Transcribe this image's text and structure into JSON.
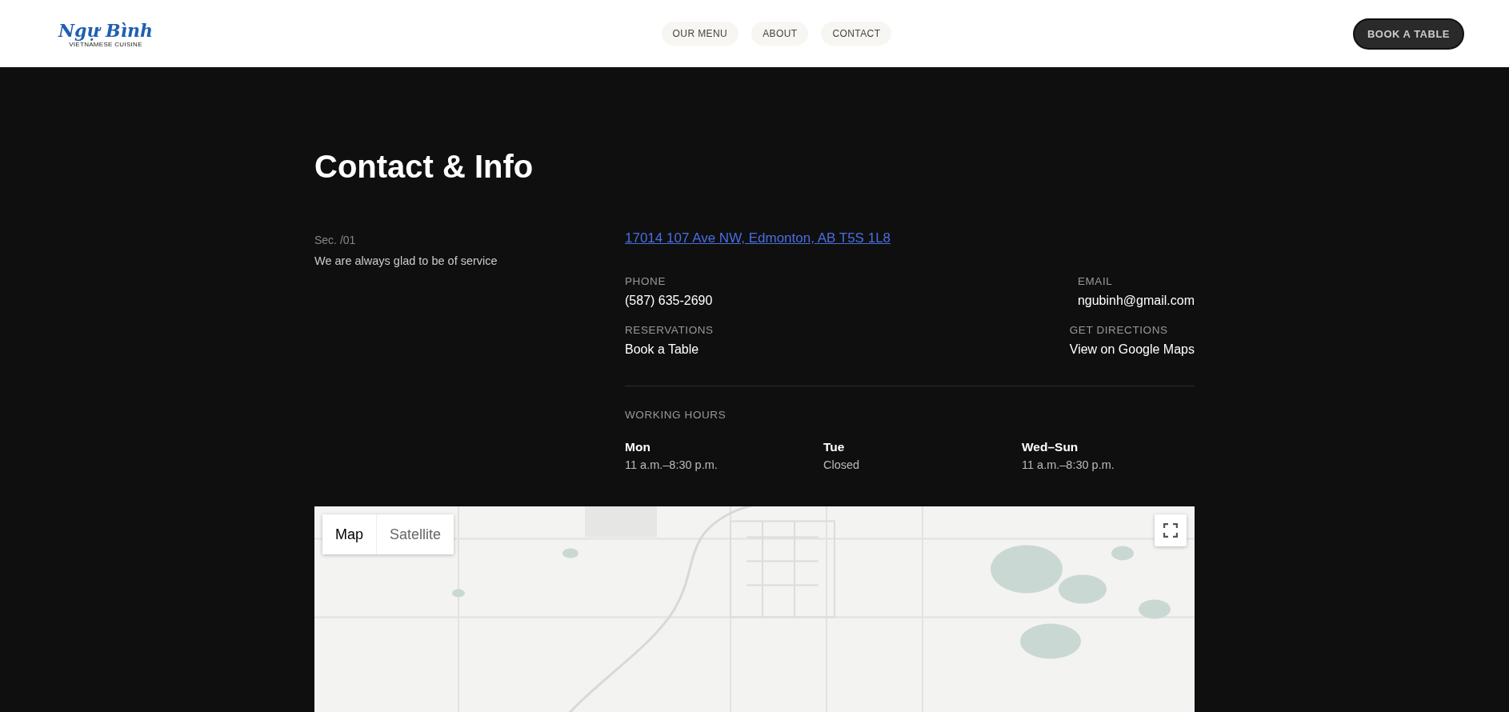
{
  "header": {
    "logo": {
      "title": "Ngự Bình",
      "subtitle": "VIETNAMESE CUISINE"
    },
    "nav": [
      {
        "label": "OUR MENU"
      },
      {
        "label": "ABOUT"
      },
      {
        "label": "CONTACT"
      }
    ],
    "cta": "BOOK A TABLE"
  },
  "contact": {
    "title": "Contact & Info",
    "section_label": "Sec. /01",
    "tagline": "We are always glad to be of service",
    "address": "17014 107 Ave NW, Edmonton, AB T5S 1L8",
    "details": [
      {
        "label": "PHONE",
        "value": "(587) 635-2690"
      },
      {
        "label": "EMAIL",
        "value": "ngubinh@gmail.com"
      },
      {
        "label": "RESERVATIONS",
        "value": "Book a Table"
      },
      {
        "label": "GET DIRECTIONS",
        "value": "View on Google Maps"
      }
    ],
    "hours": {
      "label": "WORKING HOURS",
      "days": [
        {
          "day": "Mon",
          "time": "11 a.m.–8:30 p.m."
        },
        {
          "day": "Tue",
          "time": "Closed"
        },
        {
          "day": "Wed–Sun",
          "time": "11 a.m.–8:30 p.m."
        }
      ]
    }
  },
  "map": {
    "kind": "picture",
    "tabs": [
      {
        "label": "Map",
        "selected": true
      },
      {
        "label": "Satellite",
        "selected": false
      }
    ]
  }
}
